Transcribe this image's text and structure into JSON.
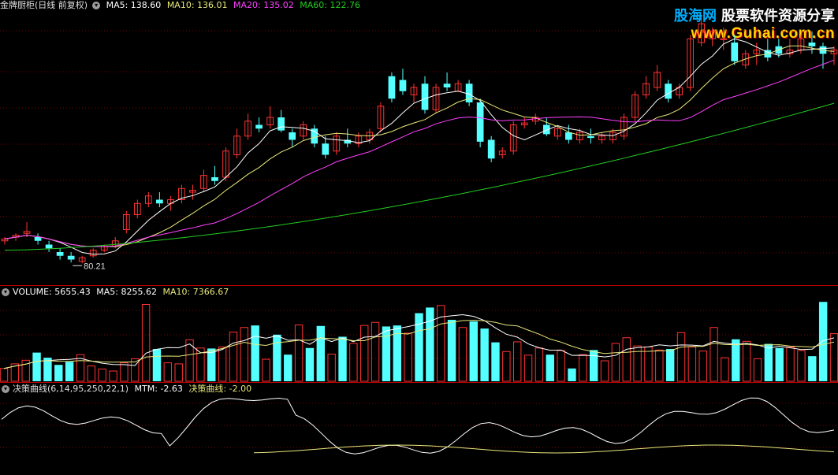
{
  "price_header": {
    "title": "金牌厨柜(日线 前复权)",
    "ma5": "MA5: 138.60",
    "ma10": "MA10: 136.01",
    "ma20": "MA20: 135.02",
    "ma60": "MA60: 122.76"
  },
  "volume_header": {
    "title": "VOLUME: 5655.43",
    "ma5": "MA5: 8255.62",
    "ma10": "MA10: 7366.67"
  },
  "indicator_header": {
    "title": "决策曲线(6,14,95,250,22,1)",
    "mtm": "MTM: -2.63",
    "curve": "决策曲线: -2.00"
  },
  "low_marker": "80.21",
  "watermark": {
    "site_name": "股海网",
    "slogan": "股票软件资源分享",
    "url": "www.Guhai.com.cn"
  },
  "colors": {
    "up": "#ff3232",
    "down": "#54ffff",
    "ma5": "#ffffff",
    "ma10": "#e8e87a",
    "ma20": "#ff40ff",
    "ma60": "#22cc22",
    "grid": "#7a0000"
  },
  "chart_data": [
    {
      "type": "candlestick",
      "title": "金牌厨柜(日线 前复权)",
      "series_names": [
        "MA5",
        "MA10",
        "MA20",
        "MA60"
      ],
      "ylim": [
        75,
        147
      ],
      "candles": [
        [
          86,
          87,
          85,
          86.5
        ],
        [
          87,
          88,
          86,
          87.5
        ],
        [
          88,
          91,
          87,
          88.5
        ],
        [
          87,
          88,
          85,
          86
        ],
        [
          85,
          86,
          83,
          84
        ],
        [
          83,
          84,
          81,
          82
        ],
        [
          82,
          83,
          80.21,
          81
        ],
        [
          80.5,
          82,
          80,
          81.5
        ],
        [
          82,
          84,
          81.5,
          83.5
        ],
        [
          83.5,
          85,
          83,
          84.5
        ],
        [
          84.5,
          87,
          84,
          86
        ],
        [
          89,
          94,
          88,
          93
        ],
        [
          93,
          97,
          92,
          96
        ],
        [
          96,
          99,
          95,
          98
        ],
        [
          97,
          99,
          95,
          96
        ],
        [
          96,
          98,
          94,
          97
        ],
        [
          97,
          101,
          96,
          100
        ],
        [
          99,
          101,
          97,
          99.5
        ],
        [
          100,
          105,
          99,
          103.5
        ],
        [
          103,
          106,
          101,
          102
        ],
        [
          103,
          111,
          102,
          110
        ],
        [
          109,
          116,
          108,
          114
        ],
        [
          114,
          120,
          113,
          118
        ],
        [
          117,
          119,
          115,
          116
        ],
        [
          117,
          122,
          116,
          119
        ],
        [
          119,
          121,
          115,
          115.5
        ],
        [
          115,
          116,
          111,
          113
        ],
        [
          114,
          118,
          113,
          117
        ],
        [
          116,
          117,
          111,
          112
        ],
        [
          112,
          114,
          108,
          109
        ],
        [
          110,
          115,
          109,
          114
        ],
        [
          113,
          116,
          111,
          112
        ],
        [
          112,
          115,
          111,
          114
        ],
        [
          113,
          116,
          112,
          115
        ],
        [
          116,
          123,
          115,
          122
        ],
        [
          130,
          131,
          123,
          124
        ],
        [
          129,
          132,
          125,
          126
        ],
        [
          125,
          128,
          123,
          127
        ],
        [
          128,
          130,
          120,
          121
        ],
        [
          121,
          128,
          120,
          127
        ],
        [
          128,
          131,
          126,
          127
        ],
        [
          126,
          129,
          126,
          128
        ],
        [
          128,
          129,
          122,
          123
        ],
        [
          123,
          124,
          111,
          112.5
        ],
        [
          113,
          114,
          107,
          108
        ],
        [
          109,
          111,
          108,
          110
        ],
        [
          110,
          118,
          109,
          117
        ],
        [
          117,
          119,
          116,
          117.5
        ],
        [
          118,
          120,
          117,
          119
        ],
        [
          117,
          119,
          114,
          114.5
        ],
        [
          114,
          117,
          113,
          116
        ],
        [
          115,
          117,
          112,
          113
        ],
        [
          113,
          116,
          112,
          115
        ],
        [
          114,
          116,
          112,
          113.5
        ],
        [
          113,
          115,
          112,
          114
        ],
        [
          113,
          116,
          112,
          115
        ],
        [
          114,
          120,
          113,
          119
        ],
        [
          119,
          126,
          118,
          125
        ],
        [
          125,
          130,
          124,
          128
        ],
        [
          127,
          133,
          126,
          131
        ],
        [
          128,
          129,
          123,
          124
        ],
        [
          125,
          128,
          124,
          127
        ],
        [
          127,
          141,
          126,
          140
        ],
        [
          139,
          146,
          138,
          144
        ],
        [
          140,
          143,
          138,
          142
        ],
        [
          140,
          143,
          137,
          140
        ],
        [
          139,
          141,
          133,
          134
        ],
        [
          133,
          137,
          132,
          136
        ],
        [
          136,
          139,
          133,
          137
        ],
        [
          137,
          140,
          134,
          135
        ],
        [
          138,
          140,
          135,
          136
        ],
        [
          136,
          140,
          135,
          137
        ],
        [
          137,
          141,
          136,
          140
        ],
        [
          139,
          142,
          136,
          138
        ],
        [
          138,
          139,
          132,
          136
        ],
        [
          136,
          138,
          133,
          137
        ]
      ],
      "ma60_range": [
        83.5,
        122.76
      ]
    },
    {
      "type": "bar",
      "title": "VOLUME",
      "series_names": [
        "VOLUME",
        "MA5",
        "MA10"
      ],
      "values": [
        2500,
        3400,
        4100,
        5600,
        4600,
        3200,
        3800,
        5200,
        3000,
        2400,
        2000,
        3600,
        4400,
        15000,
        6300,
        3600,
        3400,
        8100,
        6500,
        6400,
        6700,
        9600,
        10500,
        10900,
        4300,
        9100,
        5200,
        11000,
        6500,
        10800,
        5300,
        8700,
        7400,
        10900,
        11500,
        10700,
        10900,
        9400,
        13300,
        14400,
        14800,
        12000,
        10500,
        11700,
        10300,
        7600,
        5800,
        7700,
        5100,
        6500,
        5200,
        6000,
        2500,
        5200,
        6100,
        4000,
        7400,
        8500,
        6900,
        6700,
        6100,
        6300,
        9500,
        6700,
        5900,
        10500,
        4600,
        8200,
        7800,
        4400,
        7300,
        6500,
        6700,
        6000,
        4900,
        15500,
        9300
      ]
    },
    {
      "type": "line",
      "title": "决策曲线",
      "series_names": [
        "MTM",
        "决策曲线"
      ]
    }
  ]
}
